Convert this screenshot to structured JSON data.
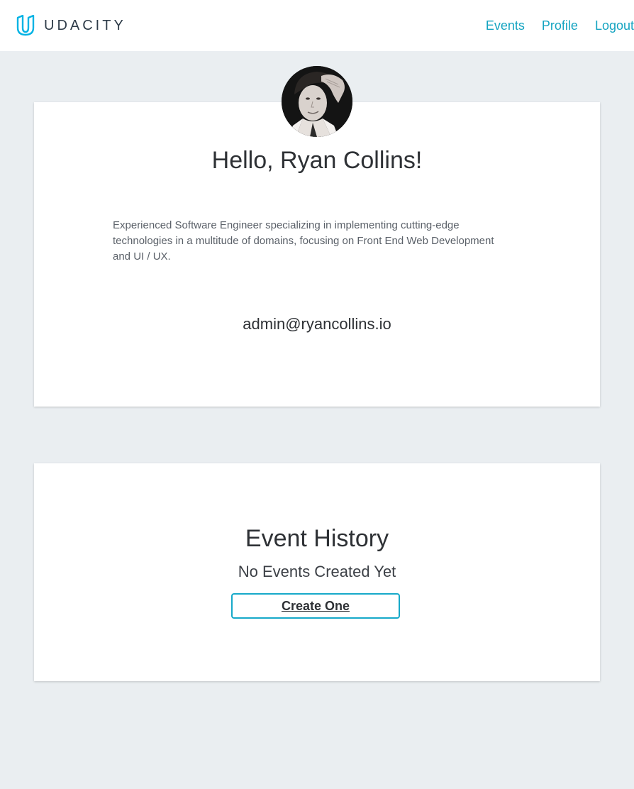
{
  "header": {
    "brand": "UDACITY",
    "nav": [
      {
        "label": "Events"
      },
      {
        "label": "Profile"
      },
      {
        "label": "Logout"
      }
    ]
  },
  "profile": {
    "greeting": "Hello, Ryan Collins!",
    "bio": "Experienced Software Engineer specializing in implementing cutting-edge technologies in a multitude of domains, focusing on Front End Web Development and UI / UX.",
    "email": "admin@ryancollins.io"
  },
  "events": {
    "title": "Event History",
    "empty_message": "No Events Created Yet",
    "create_label": "Create One"
  },
  "colors": {
    "accent": "#15a4c1",
    "background": "#eaeef1",
    "card": "#ffffff",
    "text": "#2e3135"
  }
}
